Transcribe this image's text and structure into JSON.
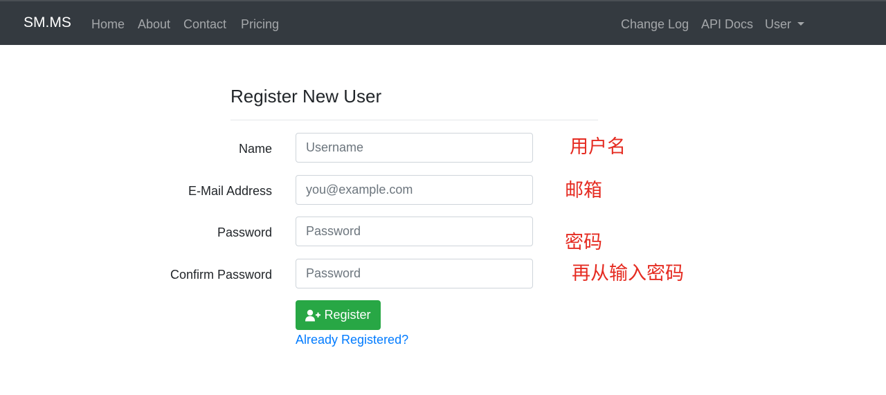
{
  "navbar": {
    "brand": "SM.MS",
    "left_links": [
      "Home",
      "About",
      "Contact",
      "Pricing"
    ],
    "right_links": [
      "Change Log",
      "API Docs"
    ],
    "user_menu": "User"
  },
  "form": {
    "title": "Register New User",
    "fields": [
      {
        "label": "Name",
        "placeholder": "Username",
        "annotation": "用户名"
      },
      {
        "label": "E-Mail Address",
        "placeholder": "you@example.com",
        "annotation": "邮箱"
      },
      {
        "label": "Password",
        "placeholder": "Password",
        "annotation": "密码"
      },
      {
        "label": "Confirm Password",
        "placeholder": "Password",
        "annotation": "再从输入密码"
      }
    ],
    "submit_label": "Register",
    "submit_icon": "user-plus-icon",
    "login_link": "Already Registered?"
  },
  "colors": {
    "navbar_bg": "#343a40",
    "submit_bg": "#28a745",
    "link": "#007bff",
    "annotation": "#e52b21"
  }
}
